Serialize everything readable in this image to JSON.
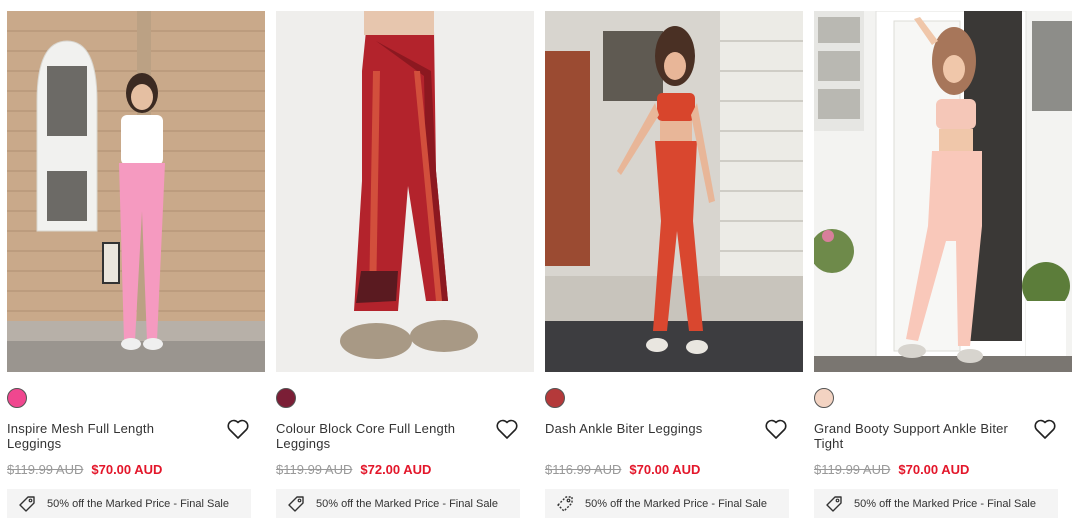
{
  "products": [
    {
      "name": "Inspire Mesh Full Length Leggings",
      "swatch_color": "#f0478f",
      "was_price": "$119.99 AUD",
      "sale_price": "$70.00 AUD",
      "promo": "50% off the Marked Price - Final Sale",
      "wishlist_icon": "heart-icon",
      "promo_icon": "tag-icon"
    },
    {
      "name": "Colour Block Core Full Length Leggings",
      "swatch_color": "#7b1e36",
      "was_price": "$119.99 AUD",
      "sale_price": "$72.00 AUD",
      "promo": "50% off the Marked Price - Final Sale",
      "wishlist_icon": "heart-icon",
      "promo_icon": "tag-icon"
    },
    {
      "name": "Dash Ankle Biter Leggings",
      "swatch_color": "#b4393a",
      "was_price": "$116.99 AUD",
      "sale_price": "$70.00 AUD",
      "promo": "50% off the Marked Price - Final Sale",
      "wishlist_icon": "heart-icon",
      "promo_icon": "tag-icon"
    },
    {
      "name": "Grand Booty Support Ankle Biter Tight",
      "swatch_color": "#f3d3c2",
      "was_price": "$119.99 AUD",
      "sale_price": "$70.00 AUD",
      "promo": "50% off the Marked Price - Final Sale",
      "wishlist_icon": "heart-icon",
      "promo_icon": "tag-icon"
    }
  ],
  "colors": {
    "sale_red": "#e3162a",
    "strike_grey": "#999999",
    "promo_bg": "#f4f4f4"
  }
}
